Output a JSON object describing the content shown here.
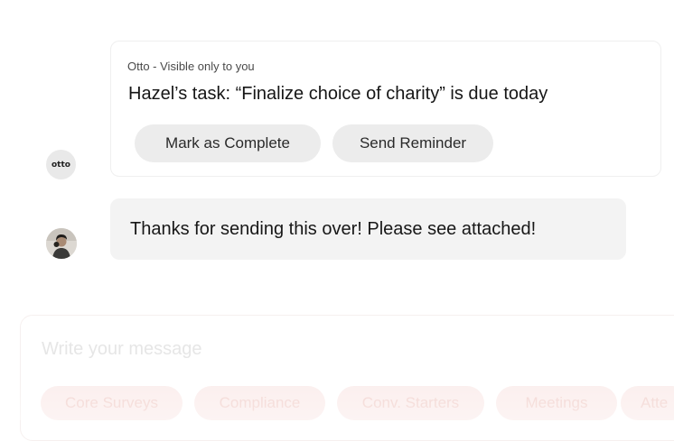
{
  "otto_message": {
    "avatar_label": "otto",
    "meta": "Otto - Visible only to you",
    "title": "Hazel’s task: “Finalize choice of charity” is due today",
    "actions": {
      "mark_complete": "Mark as Complete",
      "send_reminder": "Send Reminder"
    }
  },
  "user_message": {
    "text": "Thanks for sending this over! Please see attached!"
  },
  "composer": {
    "placeholder": "Write your message",
    "chips": [
      "Core Surveys",
      "Compliance",
      "Conv. Starters",
      "Meetings",
      "Atte"
    ]
  },
  "colors": {
    "chip_bg": "#fbeeed",
    "chip_text": "#f3d6d2",
    "bubble_bg": "#f3f3f3",
    "pill_bg": "#ececec"
  }
}
